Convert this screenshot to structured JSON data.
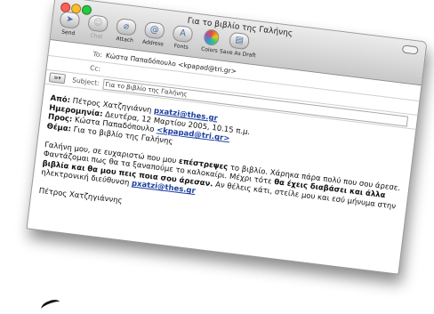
{
  "window": {
    "title": "Για το βιβλίο της Γαλήνης"
  },
  "toolbar": [
    {
      "label": "Send",
      "icon": "send-icon",
      "glyph": "➤",
      "enabled": true
    },
    {
      "label": "Chat",
      "icon": "chat-icon",
      "glyph": "☺",
      "enabled": false
    },
    {
      "label": "Attach",
      "icon": "paperclip-icon",
      "glyph": "⌀",
      "enabled": true
    },
    {
      "label": "Address",
      "icon": "address-book-icon",
      "glyph": "@",
      "enabled": true
    },
    {
      "label": "Fonts",
      "icon": "fonts-icon",
      "glyph": "A",
      "enabled": true
    },
    {
      "label": "Colors",
      "icon": "colors-icon",
      "glyph": "",
      "enabled": true
    },
    {
      "label": "Save As Draft",
      "icon": "draft-icon",
      "glyph": "▤",
      "enabled": true
    }
  ],
  "headers": {
    "to_label": "To:",
    "to_value": "Κώστα Παπαδόπουλο <kpapad@tri.gr>",
    "cc_label": "Cc:",
    "cc_value": "",
    "account_button": "≡▾",
    "subject_label": "Subject:",
    "subject_value": "Για το βιβλίο της Γαλήνης"
  },
  "message": {
    "from_label": "Από:",
    "from_name": "Πέτρος Χατζηγιάννη",
    "from_email": "pxatzi@thes.gr",
    "date_label": "Ημερομηνία:",
    "date_value": "Δευτέρα, 12 Μαρτίου 2005, 10.15 π.μ.",
    "to_label": "Προς:",
    "to_name": "Κώστα Παπαδόπουλο",
    "to_email": "<kpapad@tri.gr>",
    "subject_label": "Θέμα:",
    "subject_value": "Για το βιβλίο της Γαλήνης",
    "body_part1": "Γαλήνη μου, σε ευχαριστώ που μου",
    "body_strong1": "επέστρεψες",
    "body_part2": "το βιβλίο. Χάρηκα πάρα πολύ που σου άρεσε. Φαντάζομαι πως θα τα ξαναπούμε το καλοκαίρι. Μέχρι τότε",
    "body_strong2": "θα έχεις διαβάσει και άλλα βιβλία και θα μου πεις ποια σου άρεσαν.",
    "body_part3": "Αν θέλεις κάτι, στείλε μου και εσύ μήνυμα στην ηλεκτρονική διεύθυνση",
    "body_email": "pxatzi@thes.gr",
    "signature": "Πέτρος Χατζηγιάννης"
  }
}
